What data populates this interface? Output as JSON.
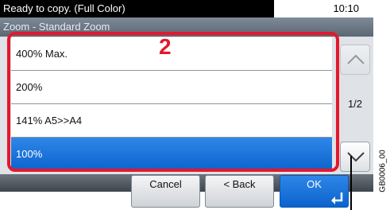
{
  "status": {
    "text": "Ready to copy. (Full Color)",
    "time": "10:10"
  },
  "screen_title": "Zoom - Standard Zoom",
  "zoom_options": [
    {
      "label": "400% Max.",
      "selected": false
    },
    {
      "label": "200%",
      "selected": false
    },
    {
      "label": "141% A5>>A4",
      "selected": false
    },
    {
      "label": "100%",
      "selected": true
    }
  ],
  "pagination": {
    "indicator": "1/2"
  },
  "buttons": {
    "cancel": "Cancel",
    "back": "< Back",
    "ok": "OK"
  },
  "annotation": {
    "step_number": "2",
    "figure_code": "GB0006_00"
  },
  "colors": {
    "highlight": "#e5172c",
    "selected": "#0b63cc"
  },
  "icons": {
    "scroll_up": "chevron-up-icon",
    "scroll_down": "chevron-down-icon",
    "enter": "enter-arrow-icon"
  }
}
